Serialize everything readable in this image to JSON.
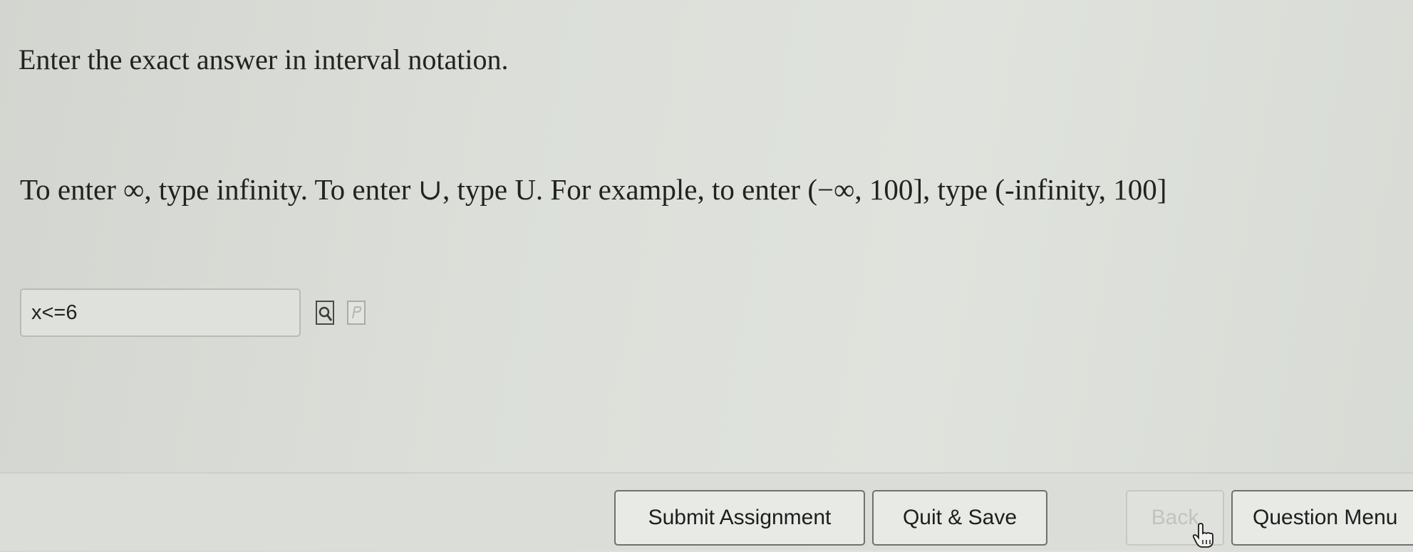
{
  "question": {
    "instruction": "Enter the exact answer in interval notation.",
    "hint": "To enter ∞, type infinity. To enter ∪, type U. For example, to enter (−∞, 100], type (-infinity, 100]"
  },
  "answer": {
    "value": "x<=6"
  },
  "tools": {
    "preview_icon": "magnifier-page-icon",
    "help_icon": "formula-help-icon"
  },
  "footer": {
    "submit_label": "Submit Assignment",
    "quit_label": "Quit & Save",
    "back_label": "Back",
    "menu_label": "Question Menu"
  },
  "colors": {
    "background": "#dcdfd9",
    "button_border": "#6f716e",
    "disabled_text": "#c2c3be"
  }
}
